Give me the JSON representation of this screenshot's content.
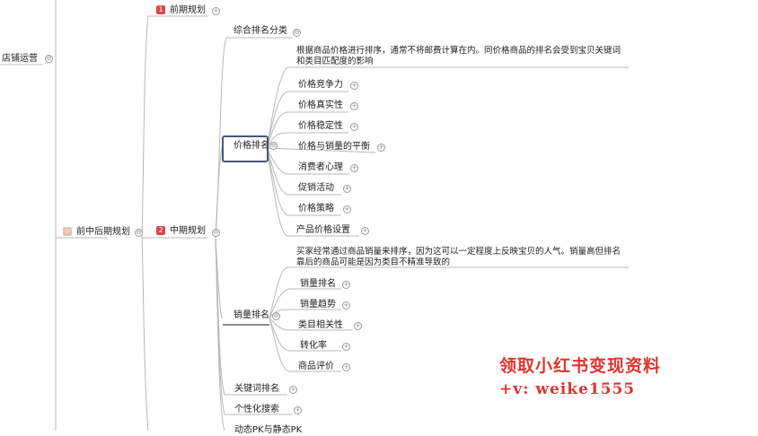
{
  "nodes": {
    "root": "店铺运营",
    "lvl1_planning": "前中后期规划",
    "phase_early": "前期规划",
    "phase_early_num": "1",
    "phase_mid": "中期规划",
    "phase_mid_num": "2",
    "comprehensive_rank": "综合排名分类",
    "price_rank": "价格排名",
    "price_rank_note": "根据商品价格进行排序，通常不将邮费计算在内。同价格商品的排名会受到宝贝关键词和类目匹配度的影响",
    "price_children": [
      "价格竞争力",
      "价格真实性",
      "价格稳定性",
      "价格与销量的平衡",
      "消费者心理",
      "促销活动",
      "价格策略",
      "产品价格设置"
    ],
    "sales_rank": "销量排名",
    "sales_rank_note": "买家经常通过商品销量来排序，因为这可以一定程度上反映宝贝的人气。销量高但排名靠后的商品可能是因为类目不精准导致的",
    "sales_children": [
      "销量排名",
      "销量趋势",
      "类目相关性",
      "转化率",
      "商品评价"
    ],
    "keyword_rank": "关键词排名",
    "personalized_search": "个性化搜索",
    "cut_off_bottom": "动态PK与静态PK"
  },
  "watermark": {
    "line1": "领取小红书变现资料",
    "line2": "+v: weike1555"
  },
  "colors": {
    "badge_early": "#d9454d",
    "badge_mid": "#d9454d",
    "selected_border": "#4a5677",
    "watermark": "#e0342e"
  }
}
